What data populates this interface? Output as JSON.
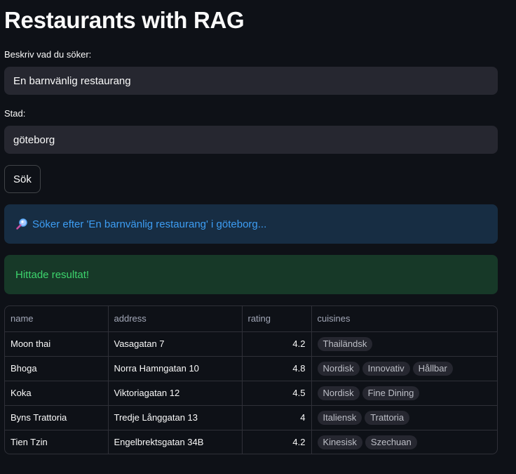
{
  "page": {
    "title": "Restaurants with RAG"
  },
  "query_field": {
    "label": "Beskriv vad du söker:",
    "value": "En barnvänlig restaurang"
  },
  "city_field": {
    "label": "Stad:",
    "value": "göteborg"
  },
  "search_button": {
    "label": "Sök"
  },
  "info_alert": {
    "icon": "magnifying-glass-icon",
    "text": "Söker efter 'En barnvänlig restaurang' i göteborg..."
  },
  "success_alert": {
    "text": "Hittade resultat!"
  },
  "table": {
    "columns": [
      "name",
      "address",
      "rating",
      "cuisines"
    ],
    "rows": [
      {
        "name": "Moon thai",
        "address": "Vasagatan 7",
        "rating": "4.2",
        "cuisines": [
          "Thailändsk"
        ]
      },
      {
        "name": "Bhoga",
        "address": "Norra Hamngatan 10",
        "rating": "4.8",
        "cuisines": [
          "Nordisk",
          "Innovativ",
          "Hållbar"
        ]
      },
      {
        "name": "Koka",
        "address": "Viktoriagatan 12",
        "rating": "4.5",
        "cuisines": [
          "Nordisk",
          "Fine Dining"
        ]
      },
      {
        "name": "Byns Trattoria",
        "address": "Tredje Långgatan 13",
        "rating": "4",
        "cuisines": [
          "Italiensk",
          "Trattoria"
        ]
      },
      {
        "name": "Tien Tzin",
        "address": "Engelbrektsgatan 34B",
        "rating": "4.2",
        "cuisines": [
          "Kinesisk",
          "Szechuan"
        ]
      }
    ]
  },
  "colors": {
    "background": "#0e1117",
    "input_bg": "#262730",
    "info_bg": "#172d43",
    "info_text": "#3d9df3",
    "success_bg": "#173928",
    "success_text": "#3dd56d"
  }
}
